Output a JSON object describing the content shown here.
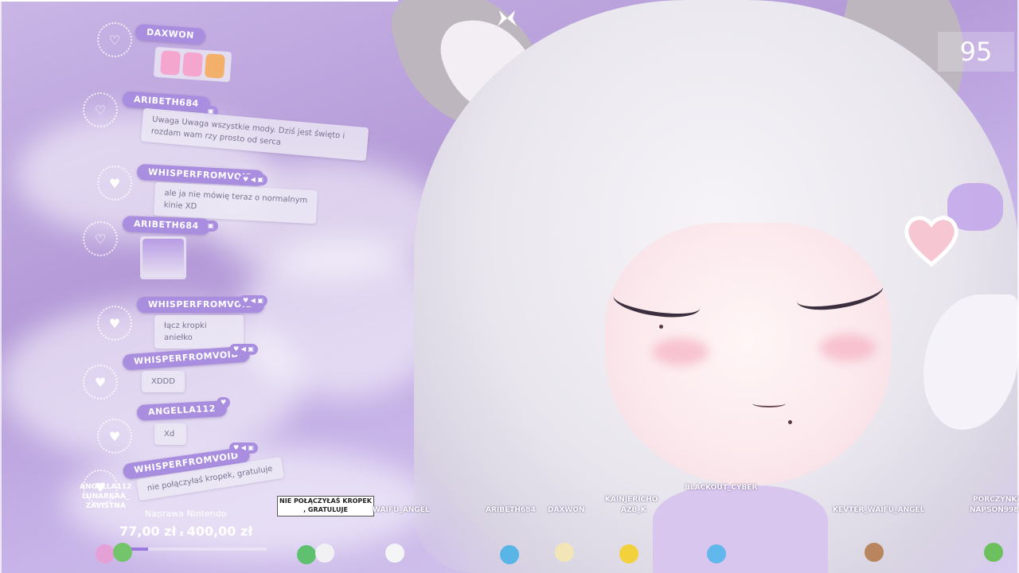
{
  "viewer_count": "95",
  "chat": [
    {
      "user": "DAXWON",
      "type": "emotes"
    },
    {
      "user": "ARIBETH684",
      "text": "Uwaga Uwaga wszystkie mody. Dziś jest święto i rozdam wam rzy prosto od serca"
    },
    {
      "user": "WHISPERFROMVOID",
      "text": "ale ja nie mówię teraz o normalnym kinie XD"
    },
    {
      "user": "ARIBETH684",
      "type": "sticker"
    },
    {
      "user": "WHISPERFROMVOID",
      "text": "łącz kropki aniełko"
    },
    {
      "user": "WHISPERFROMVOID",
      "text": "XDDD"
    },
    {
      "user": "ANGELLA112",
      "text": "Xd"
    },
    {
      "user": "WHISPERFROMVOID",
      "text": "nie połączyłaś kropek, gratuluje"
    }
  ],
  "goal": {
    "names": [
      "ANGELLA112",
      "LUNARKAA_",
      "ZAVISTNA"
    ],
    "title": "Naprawa Nintendo",
    "current": "77,00 zł",
    "separator": "z",
    "target": "400,00 zł",
    "progress": 0.1925
  },
  "speech_note": "NIE POŁĄCZYŁAŚ KROPEK , GRATULUJE",
  "crowd": {
    "waifu_angel": "WAIFU_ANGEL",
    "aribeth": "ARIBETH684",
    "daxwon": "DAXWON",
    "kainjericho": "KAINJERICHO",
    "azb_k": "AZB_K",
    "blackout": "BLACKOUT_CYBER",
    "kevter": "KEVTER_WAIFU_ANGEL",
    "porczynka": "PORCZYNKA",
    "napson": "NAPSON998"
  },
  "colors": {
    "accent": "#a98ee0",
    "bg": "#c3aee6"
  }
}
